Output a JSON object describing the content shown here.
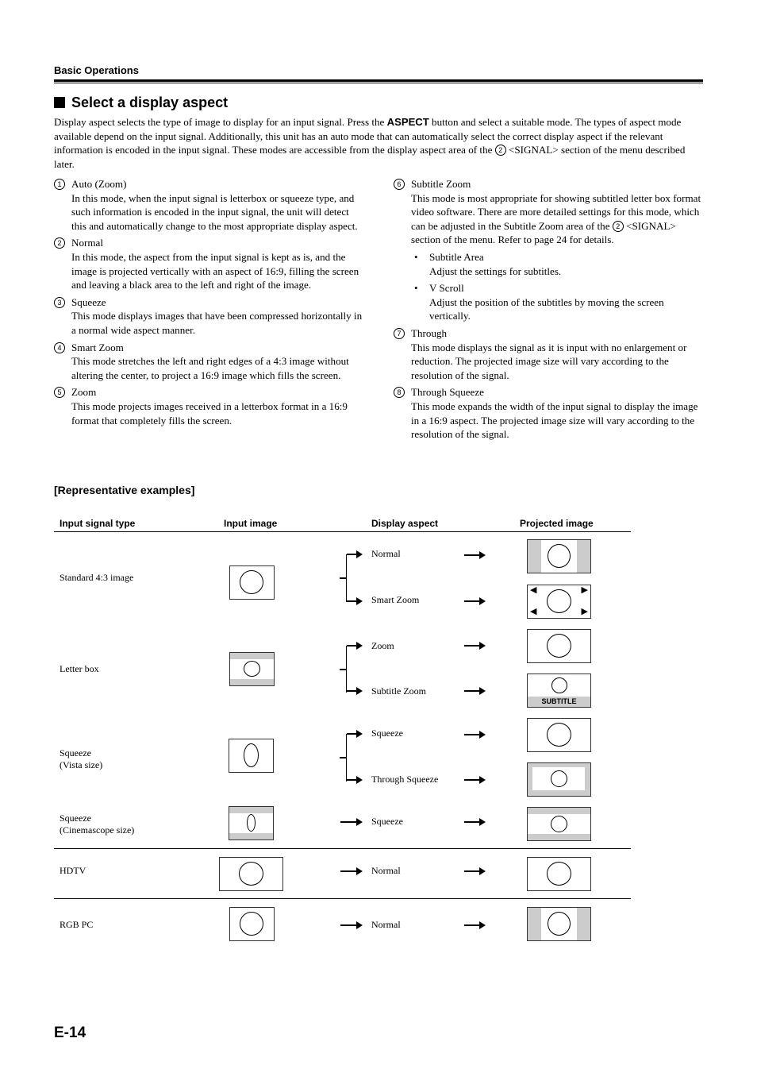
{
  "header": {
    "section": "Basic Operations"
  },
  "title": "Select a display aspect",
  "intro": {
    "before_bold": "Display aspect selects the type of image to display for an input signal. Press the ",
    "bold": "ASPECT",
    "after_bold": " button and select a suitable mode. The types of aspect mode available depend on the input signal. Additionally, this unit has an auto mode that can automatically select the correct display aspect if the relevant information is encoded in the input signal. These modes are accessible from the display aspect area of the ",
    "ref_num": "2",
    "after_ref": " <SIGNAL> section of the menu described later."
  },
  "modes": [
    {
      "num": "1",
      "name": "Auto (Zoom)",
      "desc": "In this mode, when the input signal is letterbox or squeeze type, and such information is encoded in the input signal, the unit will detect this and automatically change to the most appropriate display aspect."
    },
    {
      "num": "2",
      "name": "Normal",
      "desc": "In this mode, the aspect from the input signal is kept as is, and the image is projected vertically with an aspect of 16:9, filling the screen and leaving a black area to the left and right of the image."
    },
    {
      "num": "3",
      "name": "Squeeze",
      "desc": "This mode displays images that have been compressed horizontally in a normal wide aspect manner."
    },
    {
      "num": "4",
      "name": "Smart Zoom",
      "desc": "This mode stretches the left and right edges of a 4:3 image without altering the center, to project a 16:9 image which fills the screen."
    },
    {
      "num": "5",
      "name": "Zoom",
      "desc": "This mode projects images received in a letterbox format in a 16:9 format that completely fills the screen."
    },
    {
      "num": "6",
      "name": "Subtitle Zoom",
      "desc_before": "This mode is most appropriate for showing subtitled letter box format video software. There are more detailed settings for this mode, which can be adjusted in the Subtitle Zoom area of the ",
      "desc_ref": "2",
      "desc_after": " <SIGNAL> section of the menu. Refer to page 24 for details.",
      "bullets": [
        {
          "title": "Subtitle Area",
          "text": "Adjust the settings for subtitles."
        },
        {
          "title": "V Scroll",
          "text": "Adjust the position of the subtitles by moving the screen vertically."
        }
      ]
    },
    {
      "num": "7",
      "name": "Through",
      "desc": "This mode displays the signal as it is input with no enlargement or reduction. The projected image size will vary according to the resolution of the signal."
    },
    {
      "num": "8",
      "name": "Through Squeeze",
      "desc": "This mode expands the width of the input signal to display the image in a 16:9 aspect. The projected image size will vary according to the resolution of the signal."
    }
  ],
  "examples": {
    "heading": "[Representative examples]",
    "columns": [
      "Input signal type",
      "Input image",
      "Display aspect",
      "Projected image"
    ],
    "rows": [
      {
        "signal": "Standard 4:3 image",
        "aspects": [
          "Normal",
          "Smart Zoom"
        ]
      },
      {
        "signal": "Letter box",
        "aspects": [
          "Zoom",
          "Subtitle Zoom"
        ]
      },
      {
        "signal_line1": "Squeeze",
        "signal_line2": "(Vista size)",
        "aspects": [
          "Squeeze",
          "Through Squeeze"
        ]
      },
      {
        "signal_line1": "Squeeze",
        "signal_line2": "(Cinemascope size)",
        "aspects": [
          "Squeeze"
        ]
      },
      {
        "signal": "HDTV",
        "aspects": [
          "Normal"
        ]
      },
      {
        "signal": "RGB PC",
        "aspects": [
          "Normal"
        ]
      }
    ],
    "subtitle_label": "SUBTITLE"
  },
  "footer": {
    "page": "E-14"
  }
}
